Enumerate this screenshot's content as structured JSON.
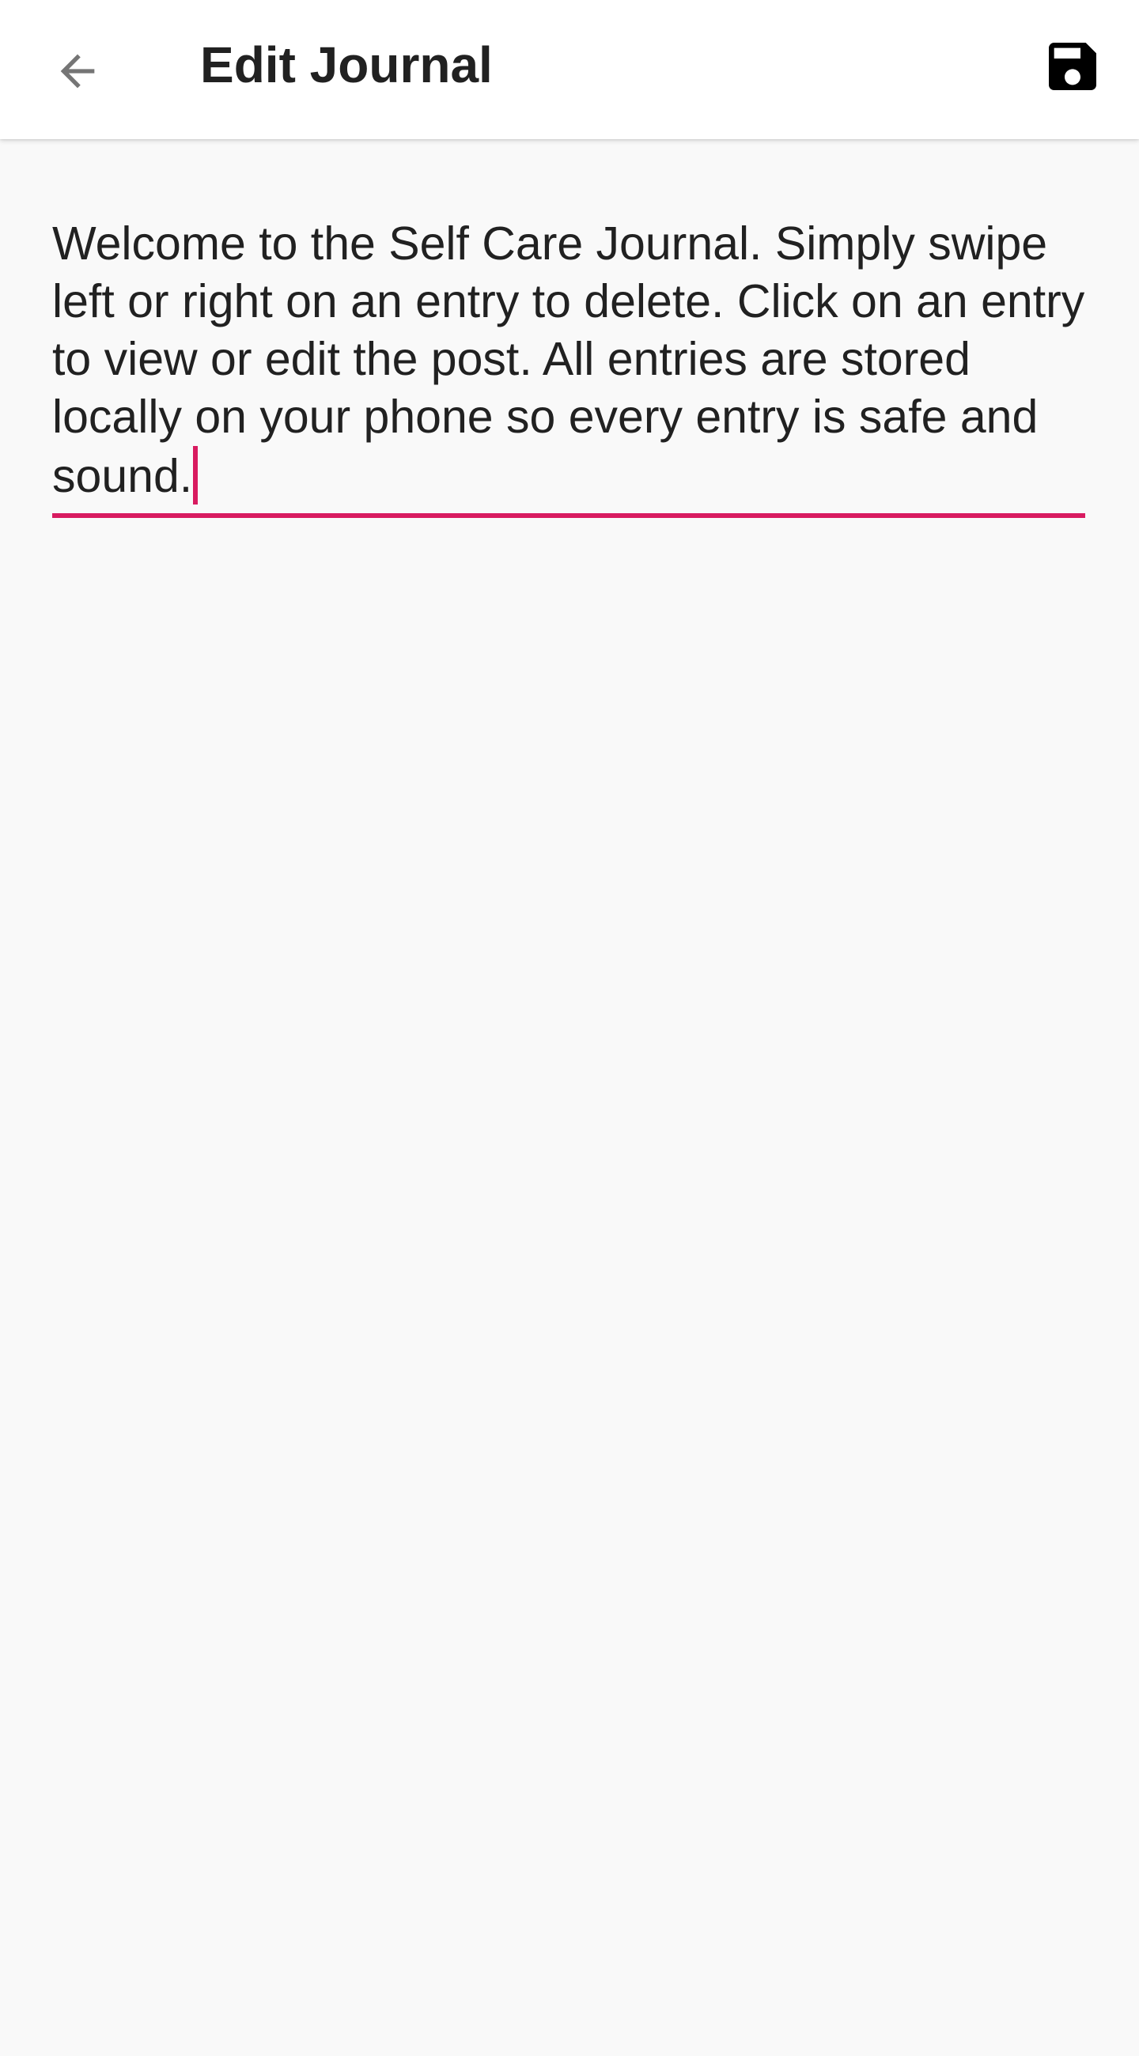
{
  "app_bar": {
    "title": "Edit Journal",
    "back_icon": "arrow-back-icon",
    "save_icon": "floppy-disk-icon"
  },
  "editor": {
    "value": "Welcome to the Self Care Journal. Simply swipe left or right on an entry to delete. Click on an entry to view or edit the post. All entries are stored locally on your phone so every entry is safe and sound."
  },
  "colors": {
    "accent": "#d81b60",
    "app_bar_background": "#ffffff",
    "page_background": "#f9f9f9",
    "text": "#212121",
    "icon_grey": "#757575",
    "save_icon": "#000000"
  }
}
